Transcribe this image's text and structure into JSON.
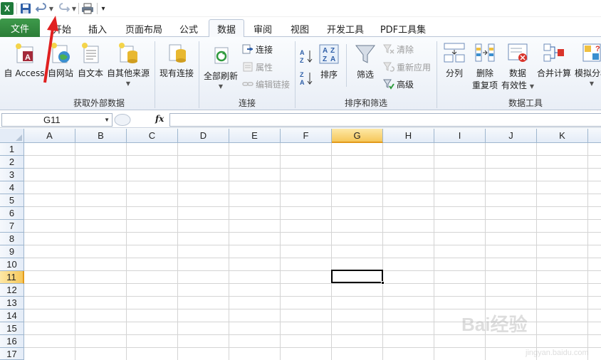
{
  "app": {
    "logo_letter": "X"
  },
  "tabs": [
    {
      "label": "文件"
    },
    {
      "label": "开始"
    },
    {
      "label": "插入"
    },
    {
      "label": "页面布局"
    },
    {
      "label": "公式"
    },
    {
      "label": "数据"
    },
    {
      "label": "审阅"
    },
    {
      "label": "视图"
    },
    {
      "label": "开发工具"
    },
    {
      "label": "PDF工具集"
    }
  ],
  "ribbon": {
    "external": {
      "group_label": "获取外部数据",
      "from_access": "自 Access",
      "from_web": "自网站",
      "from_text": "自文本",
      "from_other": "自其他来源",
      "existing": "现有连接"
    },
    "connections": {
      "group_label": "连接",
      "refresh_all": "全部刷新",
      "connections": "连接",
      "properties": "属性",
      "edit_links": "编辑链接"
    },
    "sort_filter": {
      "group_label": "排序和筛选",
      "sort": "排序",
      "filter": "筛选",
      "clear": "清除",
      "reapply": "重新应用",
      "advanced": "高级"
    },
    "data_tools": {
      "group_label": "数据工具",
      "text_to_columns": "分列",
      "remove_dup_line1": "删除",
      "remove_dup_line2": "重复项",
      "validation_line1": "数据",
      "validation_line2": "有效性",
      "consolidate": "合并计算",
      "what_if": "模拟分析"
    }
  },
  "formula_bar": {
    "name_box": "G11",
    "fx": "fx",
    "content": ""
  },
  "sheet": {
    "columns": [
      "A",
      "B",
      "C",
      "D",
      "E",
      "F",
      "G",
      "H",
      "I",
      "J",
      "K"
    ],
    "rows": [
      "1",
      "2",
      "3",
      "4",
      "5",
      "6",
      "7",
      "8",
      "9",
      "10",
      "11",
      "12",
      "13",
      "14",
      "15",
      "16",
      "17"
    ],
    "selected_cell": "G11"
  },
  "watermark": {
    "text": "Bai经验",
    "sub": "jingyan.baidu.com"
  },
  "colors": {
    "file_tab": "#2b7d37",
    "selection_header": "#f6c75a",
    "annotation_arrow": "#e02020"
  }
}
